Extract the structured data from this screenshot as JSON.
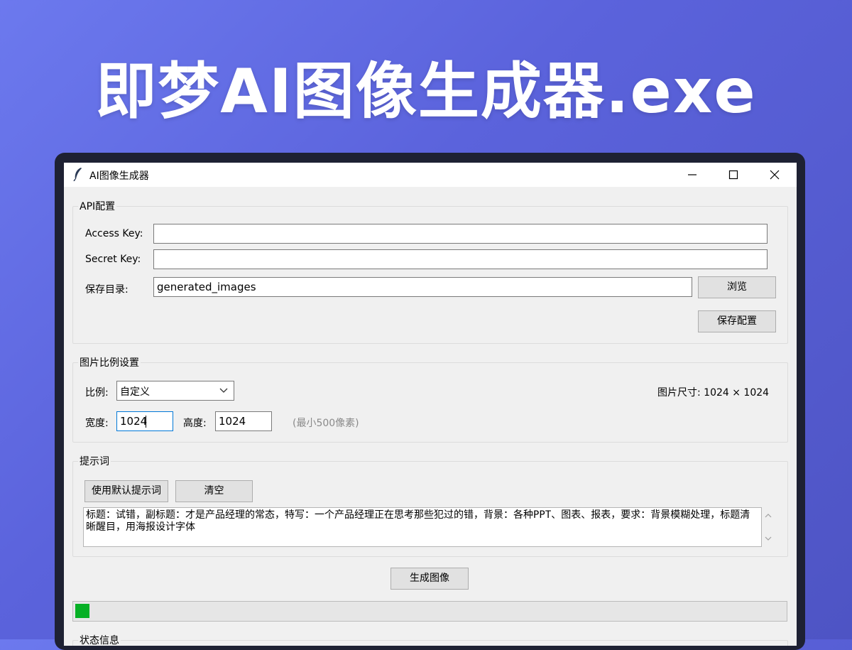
{
  "headline": "即梦AI图像生成器.exe",
  "window": {
    "title": "AI图像生成器"
  },
  "api": {
    "group_label": "API配置",
    "access_key_label": "Access Key:",
    "access_key_value": "",
    "secret_key_label": "Secret Key:",
    "secret_key_value": "",
    "save_dir_label": "保存目录:",
    "save_dir_value": "generated_images",
    "browse_label": "浏览",
    "save_config_label": "保存配置"
  },
  "ratio": {
    "group_label": "图片比例设置",
    "ratio_label": "比例:",
    "ratio_value": "自定义",
    "size_display": "图片尺寸: 1024 × 1024",
    "width_label": "宽度:",
    "width_value": "1024",
    "height_label": "高度:",
    "height_value": "1024",
    "hint": "(最小500像素)"
  },
  "prompt": {
    "group_label": "提示词",
    "default_button": "使用默认提示词",
    "clear_button": "清空",
    "text": "标题：试错，副标题：才是产品经理的常态，特写：一个产品经理正在思考那些犯过的错，背景：各种PPT、图表、报表，要求：背景模糊处理，标题清晰醒目，用海报设计字体"
  },
  "generate_button": "生成图像",
  "progress": {
    "value": 0.02
  },
  "status": {
    "group_label": "状态信息"
  },
  "colors": {
    "accent": "#06b025",
    "background_top": "#6c79ee",
    "background_bottom": "#4e54c4"
  }
}
